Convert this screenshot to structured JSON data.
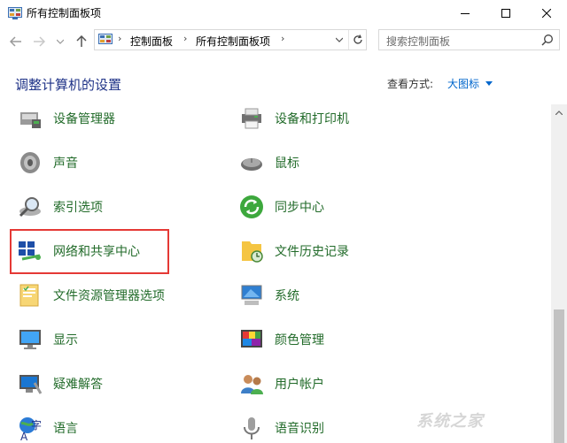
{
  "window": {
    "title": "所有控制面板项",
    "icon": "control-panel-icon"
  },
  "navigation": {
    "breadcrumb": [
      "控制面板",
      "所有控制面板项"
    ],
    "breadcrumb_sep": "›"
  },
  "search": {
    "placeholder": "搜索控制面板"
  },
  "header": {
    "title": "调整计算机的设置",
    "view_label": "查看方式:",
    "view_value": "大图标"
  },
  "items": [
    {
      "label": "设备管理器",
      "icon": "device-manager-icon"
    },
    {
      "label": "设备和打印机",
      "icon": "printer-icon"
    },
    {
      "label": "声音",
      "icon": "speaker-icon"
    },
    {
      "label": "鼠标",
      "icon": "mouse-icon"
    },
    {
      "label": "索引选项",
      "icon": "indexing-icon"
    },
    {
      "label": "同步中心",
      "icon": "sync-icon"
    },
    {
      "label": "网络和共享中心",
      "icon": "network-icon"
    },
    {
      "label": "文件历史记录",
      "icon": "file-history-icon"
    },
    {
      "label": "文件资源管理器选项",
      "icon": "folder-options-icon"
    },
    {
      "label": "系统",
      "icon": "system-icon"
    },
    {
      "label": "显示",
      "icon": "display-icon"
    },
    {
      "label": "颜色管理",
      "icon": "color-management-icon"
    },
    {
      "label": "疑难解答",
      "icon": "troubleshooting-icon"
    },
    {
      "label": "用户帐户",
      "icon": "user-accounts-icon"
    },
    {
      "label": "语言",
      "icon": "language-icon"
    },
    {
      "label": "语音识别",
      "icon": "microphone-icon"
    }
  ],
  "colors": {
    "title_blue": "#1e3287",
    "link_blue": "#0066cc",
    "item_green": "#226b2a",
    "highlight_red": "#e53935"
  },
  "watermark": "系统之家"
}
